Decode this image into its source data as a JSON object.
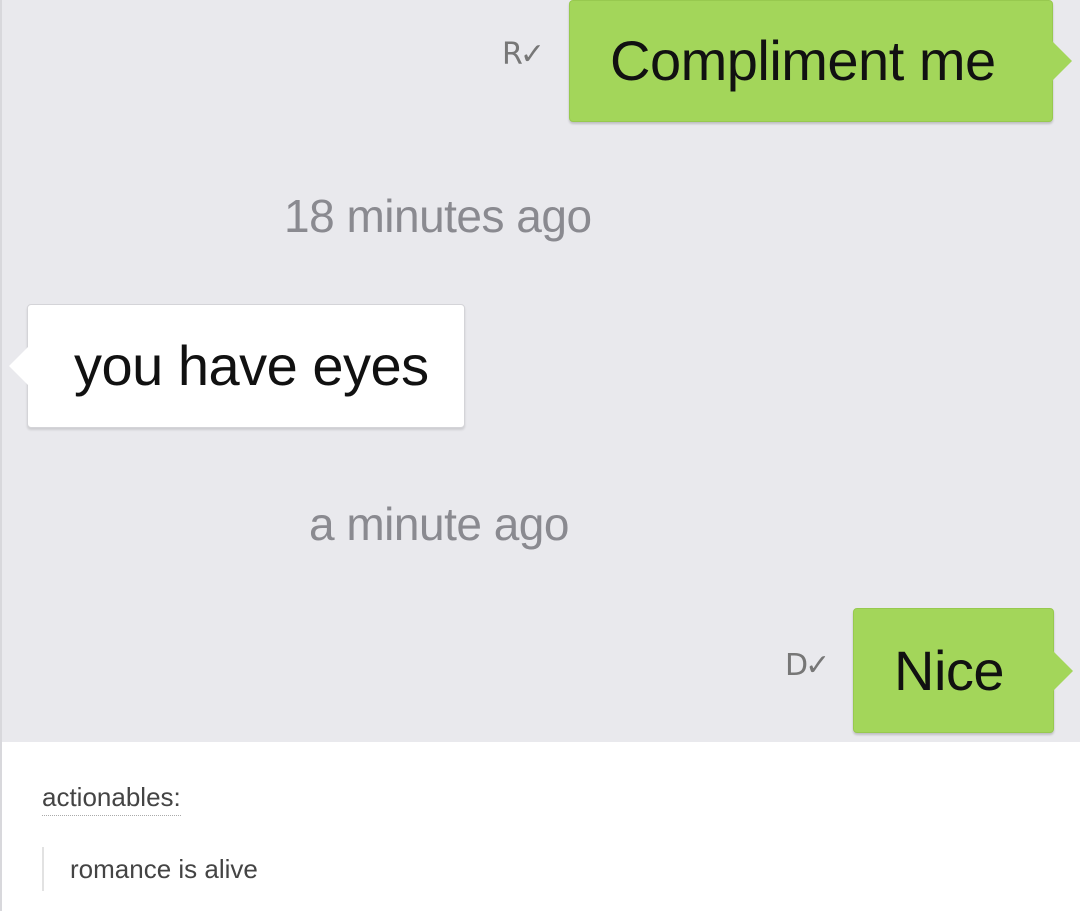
{
  "conversation": {
    "messages": [
      {
        "type": "sent",
        "text": "Compliment me",
        "status_mark": "R"
      },
      {
        "type": "timestamp",
        "text": "18 minutes ago"
      },
      {
        "type": "received",
        "text": "you have eyes"
      },
      {
        "type": "timestamp",
        "text": "a minute ago"
      },
      {
        "type": "sent",
        "text": "Nice",
        "status_mark": "D"
      }
    ]
  },
  "caption": {
    "username": "actionables:",
    "text": "romance is alive"
  },
  "colors": {
    "sent_bubble": "#a3d65a",
    "received_bubble": "#ffffff",
    "chat_background": "#e9e9ed",
    "timestamp": "#8a8a90"
  },
  "icons": {
    "status_mark": "checkmark-icon"
  }
}
